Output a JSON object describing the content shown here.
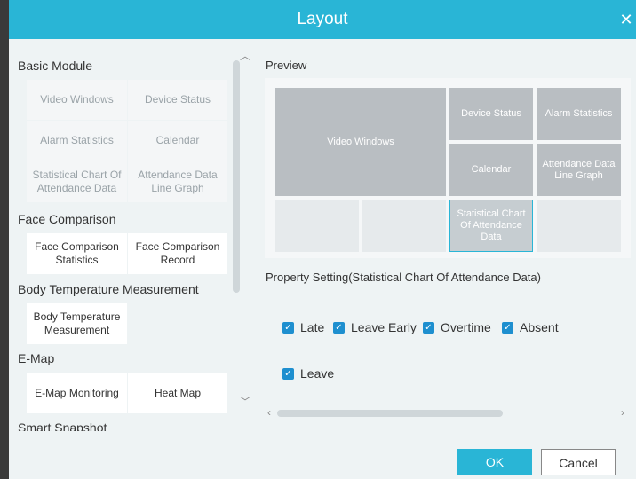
{
  "window": {
    "title": "Layout",
    "close_glyph": "✕"
  },
  "sidebar": {
    "sections": [
      {
        "title": "Basic Module",
        "items": [
          "Video Windows",
          "Device Status",
          "Alarm Statistics",
          "Calendar",
          "Statistical Chart Of Attendance Data",
          "Attendance Data Line Graph"
        ]
      },
      {
        "title": "Face Comparison",
        "items": [
          "Face Comparison Statistics",
          "Face Comparison Record"
        ]
      },
      {
        "title": "Body Temperature Measurement",
        "items": [
          "Body Temperature Measurement"
        ]
      },
      {
        "title": "E-Map",
        "items": [
          "E-Map Monitoring",
          "Heat Map"
        ]
      },
      {
        "title": "Smart Snapshot"
      }
    ]
  },
  "preview": {
    "label": "Preview",
    "cells": {
      "video_windows": "Video Windows",
      "device_status": "Device Status",
      "alarm_statistics": "Alarm Statistics",
      "calendar": "Calendar",
      "attendance_line_graph": "Attendance Data Line Graph",
      "statistical_chart": "Statistical Chart Of Attendance Data"
    }
  },
  "property": {
    "label": "Property Setting(Statistical Chart Of Attendance Data)",
    "options": [
      {
        "label": "Late",
        "checked": true
      },
      {
        "label": "Leave Early",
        "checked": true
      },
      {
        "label": "Overtime",
        "checked": true
      },
      {
        "label": "Absent",
        "checked": true
      },
      {
        "label": "Leave",
        "checked": true
      }
    ]
  },
  "buttons": {
    "ok": "OK",
    "cancel": "Cancel"
  },
  "colors": {
    "accent": "#29b5d6",
    "checkbox": "#1e8fcf"
  }
}
